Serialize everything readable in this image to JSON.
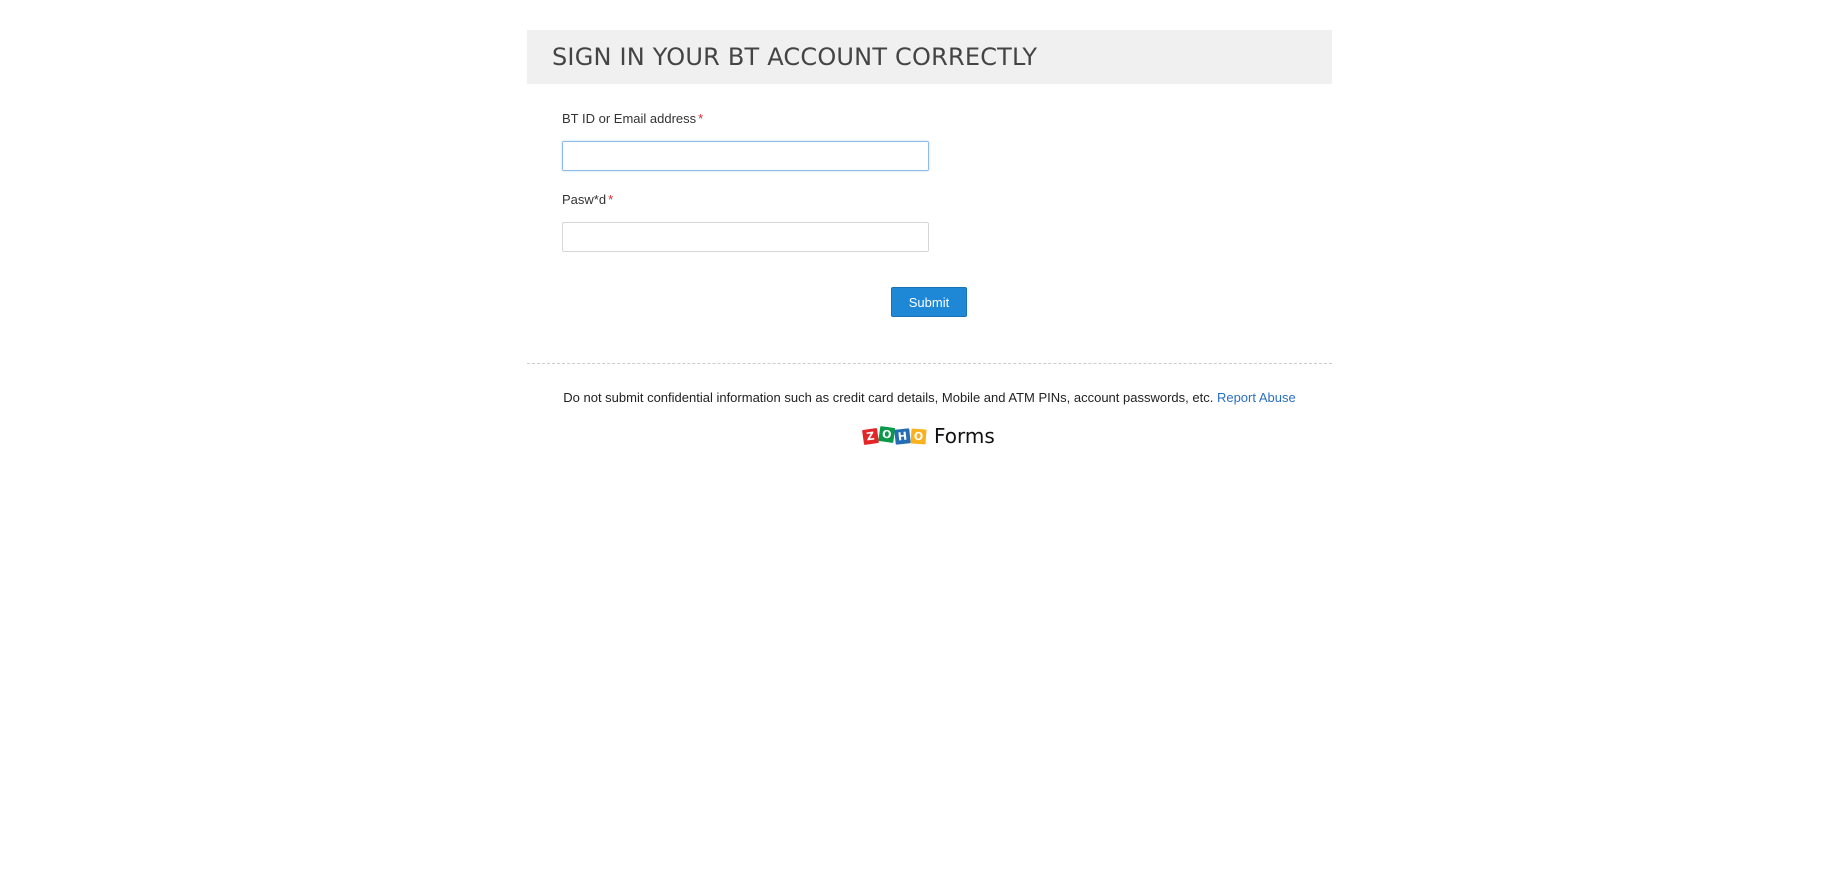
{
  "form": {
    "title": "SIGN IN YOUR BT ACCOUNT CORRECTLY",
    "fields": [
      {
        "label": "BT ID or Email address",
        "required_mark": "*",
        "value": ""
      },
      {
        "label": "Pasw*d",
        "required_mark": "*",
        "value": ""
      }
    ],
    "submit_label": "Submit"
  },
  "footer": {
    "note": "Do not submit confidential information such as credit card details, Mobile and ATM PINs, account passwords, etc.",
    "report_link": "Report Abuse",
    "brand_letters": [
      "Z",
      "O",
      "H",
      "O"
    ],
    "brand_colors": [
      "#e42527",
      "#089949",
      "#226db4",
      "#f9b21d"
    ],
    "brand_name": "Forms"
  },
  "colors": {
    "accent": "#1e88d6",
    "required": "#e0282e",
    "link": "#2b6fc2",
    "header_bg": "#f0f0f0"
  }
}
